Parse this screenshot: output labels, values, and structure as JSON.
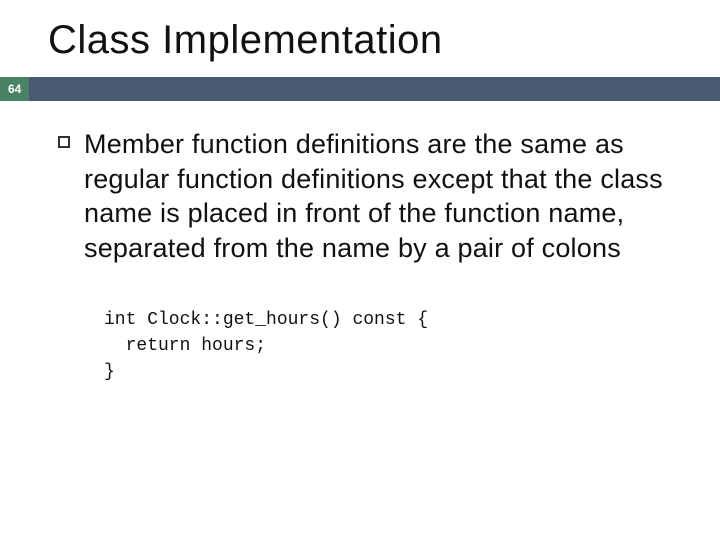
{
  "title": "Class Implementation",
  "page_number": "64",
  "bullet_text": "Member function definitions are the same as regular function definitions except that the class name is placed in front of the function name, separated from the name by a pair of colons",
  "code_line1": "int Clock::get_hours() const {",
  "code_line2": "  return hours;",
  "code_line3": "}"
}
